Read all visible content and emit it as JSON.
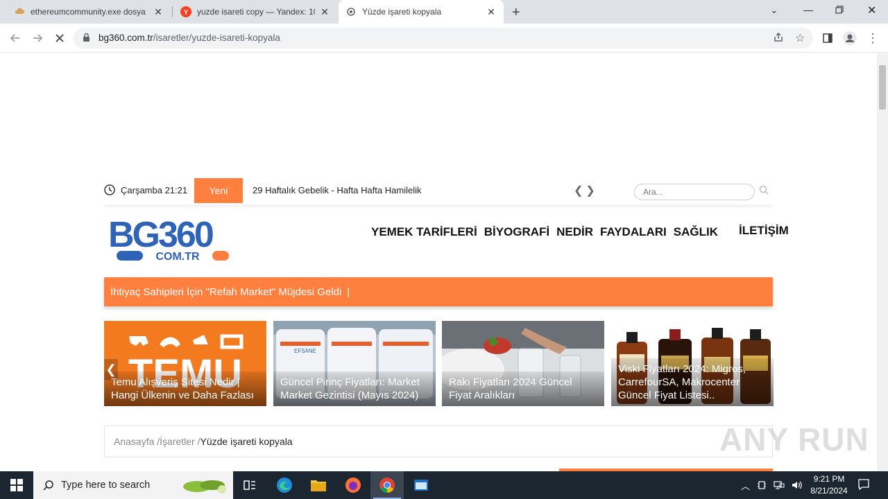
{
  "browser": {
    "tabs": [
      {
        "title": "ethereumcommunity.exe dosya",
        "active": false
      },
      {
        "title": "yuzde isareti copy — Yandex: 10",
        "active": false
      },
      {
        "title": "Yüzde işareti kopyala",
        "active": true
      }
    ],
    "url_host": "bg360.com.tr",
    "url_path": "/isaretler/yuzde-isareti-kopyala"
  },
  "site": {
    "date": "Çarşamba 21:21",
    "new_label": "Yeni",
    "ticker": "29 Haftalık Gebelik - Hafta Hafta Hamilelik",
    "ticker_arrows": "❮❯",
    "search_placeholder": "Ara...",
    "logo_top": "BG360",
    "logo_bottom": "COM.TR",
    "nav": [
      "YEMEK TARİFLERİ",
      "BİYOGRAFİ",
      "NEDİR",
      "FAYDALARI",
      "SAĞLIK"
    ],
    "nav_contact": "İLETİŞİM",
    "announcement": "İhtiyaç Sahipleri İçin \"Refah Market\" Müjdesi Geldi",
    "cards": [
      {
        "caption": "Temu Alışveriş Sitesi Nedir | Hangi Ülkenin ve Daha Fazlası",
        "image_text": "TEMU"
      },
      {
        "caption": "Güncel Pirinç Fiyatları: Market Market Gezintisi (Mayıs 2024)",
        "image_text": "EFSANE"
      },
      {
        "caption": "Rakı Fiyatları 2024 Güncel Fiyat Aralıkları",
        "image_text": ""
      },
      {
        "caption": "Viski Fiyatları 2024: Migros, CarrefourSA, Makrocenter Güncel Fiyat Listesi..",
        "image_text": ""
      }
    ],
    "slider_prev": "❮",
    "breadcrumb": {
      "home": "Anasayfa",
      "cat": "İşaretler",
      "current": "Yüzde işareti kopyala",
      "sep": "/"
    },
    "watermark": "ANY RUN"
  },
  "taskbar": {
    "search_placeholder": "Type here to search",
    "time": "9:21 PM",
    "date": "8/21/2024"
  },
  "colors": {
    "accent": "#ff7f3f",
    "logo_blue": "#2f63b8"
  }
}
